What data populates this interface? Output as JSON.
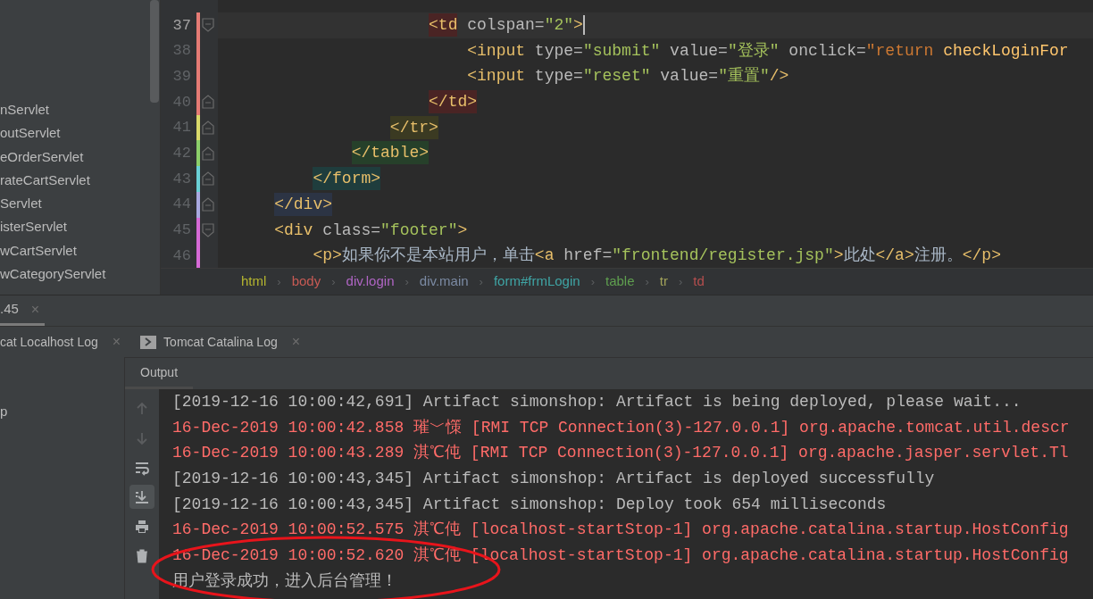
{
  "project_tree": {
    "items": [
      {
        "label": "nServlet"
      },
      {
        "label": "outServlet"
      },
      {
        "label": "eOrderServlet"
      },
      {
        "label": "rateCartServlet"
      },
      {
        "label": "Servlet"
      },
      {
        "label": "isterServlet"
      },
      {
        "label": "wCartServlet"
      },
      {
        "label": "wCategoryServlet"
      }
    ]
  },
  "editor": {
    "lines": [
      {
        "number": "37",
        "current": true,
        "kind": "fold-start",
        "color": "#e57b74",
        "segments": [
          {
            "kind": "tag",
            "text": "                    <td",
            "color": "#4a2424"
          },
          {
            "kind": "attr",
            "text": " colspan="
          },
          {
            "kind": "str",
            "text": "\"2\""
          },
          {
            "kind": "tag",
            "text": ">"
          }
        ]
      },
      {
        "number": "38",
        "current": false,
        "kind": "plain",
        "color": "#e57b74",
        "segments": [
          {
            "kind": "tag",
            "text": "                        <input"
          },
          {
            "kind": "attr",
            "text": " type="
          },
          {
            "kind": "str",
            "text": "\"submit\""
          },
          {
            "kind": "attr",
            "text": " value="
          },
          {
            "kind": "str",
            "text": "\"登录\""
          },
          {
            "kind": "attr",
            "text": " onclick="
          },
          {
            "kind": "js",
            "text": "\"return"
          },
          {
            "kind": "fn",
            "text": " checkLoginFor"
          }
        ]
      },
      {
        "number": "39",
        "current": false,
        "kind": "plain",
        "color": "#e57b74",
        "segments": [
          {
            "kind": "tag",
            "text": "                        <input"
          },
          {
            "kind": "attr",
            "text": " type="
          },
          {
            "kind": "str",
            "text": "\"reset\""
          },
          {
            "kind": "attr",
            "text": " value="
          },
          {
            "kind": "str",
            "text": "\"重置\""
          },
          {
            "kind": "tag",
            "text": "/>"
          }
        ]
      },
      {
        "number": "40",
        "current": false,
        "kind": "fold-end",
        "color": "#e57b74",
        "segments": [
          {
            "kind": "tag",
            "text": "                    </td>",
            "color": "#4a2424"
          }
        ]
      },
      {
        "number": "41",
        "current": false,
        "kind": "fold-end",
        "color": "#d9d96a",
        "segments": [
          {
            "kind": "tag",
            "text": "                </tr>",
            "color": "#3b3a22"
          }
        ]
      },
      {
        "number": "42",
        "current": false,
        "kind": "fold-end",
        "color": "#8ccf6a",
        "segments": [
          {
            "kind": "tag",
            "text": "            </table>",
            "color": "#26402a"
          }
        ]
      },
      {
        "number": "43",
        "current": false,
        "kind": "fold-end",
        "color": "#6ad0d6",
        "segments": [
          {
            "kind": "tag",
            "text": "        </form>",
            "color": "#1f3d3d"
          }
        ]
      },
      {
        "number": "44",
        "current": false,
        "kind": "fold-end",
        "color": "#a9a9e0",
        "segments": [
          {
            "kind": "tag",
            "text": "    </div>",
            "color": "#2c3444"
          }
        ]
      },
      {
        "number": "45",
        "current": false,
        "kind": "fold-start",
        "color": "#d66ad6",
        "segments": [
          {
            "kind": "tag",
            "text": "    <div"
          },
          {
            "kind": "attr",
            "text": " class="
          },
          {
            "kind": "str",
            "text": "\"footer\""
          },
          {
            "kind": "tag",
            "text": ">"
          }
        ]
      },
      {
        "number": "46",
        "current": false,
        "kind": "plain",
        "color": "#d66ad6",
        "segments": [
          {
            "kind": "tag",
            "text": "        <p>"
          },
          {
            "kind": "text",
            "text": "如果你不是本站用户，单击"
          },
          {
            "kind": "tag",
            "text": "<a"
          },
          {
            "kind": "attr",
            "text": " href="
          },
          {
            "kind": "str",
            "text": "\"frontend/register.jsp\""
          },
          {
            "kind": "tag",
            "text": ">"
          },
          {
            "kind": "text",
            "text": "此处"
          },
          {
            "kind": "tag",
            "text": "</a>"
          },
          {
            "kind": "text",
            "text": "注册。"
          },
          {
            "kind": "tag",
            "text": "</p>"
          }
        ]
      }
    ]
  },
  "breadcrumb": [
    {
      "label": "html",
      "color": "#b5b52f"
    },
    {
      "separator": "›",
      "label": "body",
      "color": "#c75a54"
    },
    {
      "separator": "›",
      "label": "div.login",
      "color": "#b065c4"
    },
    {
      "separator": "›",
      "label": "div.main",
      "color": "#7b8aa3"
    },
    {
      "separator": "›",
      "label": "form#frmLogin",
      "color": "#3fa5a5"
    },
    {
      "separator": "›",
      "label": "table",
      "color": "#5f9f4f"
    },
    {
      "separator": "›",
      "label": "tr",
      "color": "#a3a35a"
    },
    {
      "separator": "›",
      "label": "td",
      "color": "#b54e4e"
    }
  ],
  "run_tabs": [
    {
      "label": ".45",
      "close": "×",
      "selected": true
    }
  ],
  "log_tabs": [
    {
      "label": "cat Localhost Log",
      "close": "×",
      "selected": false
    },
    {
      "label": "Tomcat Catalina Log",
      "close": "×",
      "selected": false
    }
  ],
  "deployments": [
    {
      "label": "p"
    }
  ],
  "output_tab": {
    "label": "Output",
    "selected": true
  },
  "console_toolbar": [
    {
      "kind": "up",
      "selected": false
    },
    {
      "kind": "down",
      "selected": false
    },
    {
      "kind": "wrap",
      "selected": false
    },
    {
      "kind": "scroll-end",
      "selected": true
    },
    {
      "kind": "print",
      "selected": false
    },
    {
      "kind": "trash",
      "selected": false
    }
  ],
  "console": [
    {
      "kind": "info",
      "text": "[2019-12-16 10:00:42,691] Artifact simonshop: Artifact is being deployed, please wait..."
    },
    {
      "kind": "error",
      "text": "16-Dec-2019 10:00:42.858 璀﹀憡 [RMI TCP Connection(3)-127.0.0.1] org.apache.tomcat.util.descr"
    },
    {
      "kind": "error",
      "text": "16-Dec-2019 10:00:43.289 淇℃伅 [RMI TCP Connection(3)-127.0.0.1] org.apache.jasper.servlet.Tl"
    },
    {
      "kind": "info",
      "text": "[2019-12-16 10:00:43,345] Artifact simonshop: Artifact is deployed successfully"
    },
    {
      "kind": "info",
      "text": "[2019-12-16 10:00:43,345] Artifact simonshop: Deploy took 654 milliseconds"
    },
    {
      "kind": "error",
      "text": "16-Dec-2019 10:00:52.575 淇℃伅 [localhost-startStop-1] org.apache.catalina.startup.HostConfig"
    },
    {
      "kind": "error",
      "text": "16-Dec-2019 10:00:52.620 淇℃伅 [localhost-startStop-1] org.apache.catalina.startup.HostConfig"
    },
    {
      "kind": "info",
      "text": "用户登录成功，进入后台管理！"
    }
  ],
  "annotations": [
    {
      "kind": "ellipse"
    }
  ]
}
